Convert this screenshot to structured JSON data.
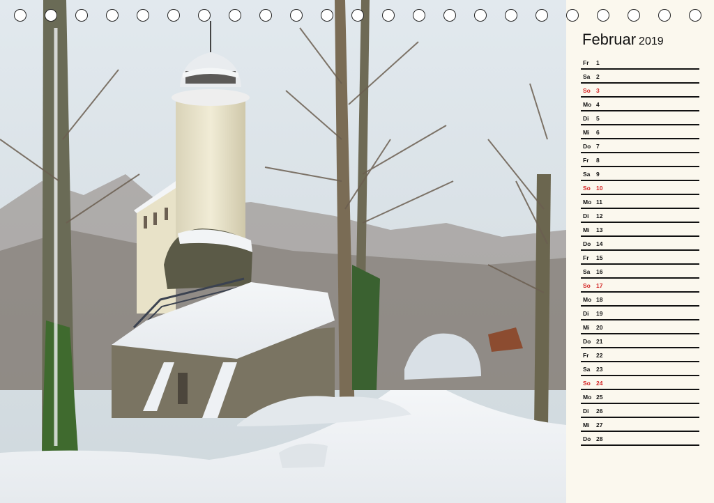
{
  "calendar": {
    "month": "Februar",
    "year": "2019",
    "colors": {
      "sunday": "#d32121",
      "text": "#111111",
      "panel_bg": "#fbf8ee"
    },
    "days": [
      {
        "name": "Fr",
        "num": "1",
        "sunday": false
      },
      {
        "name": "Sa",
        "num": "2",
        "sunday": false
      },
      {
        "name": "So",
        "num": "3",
        "sunday": true
      },
      {
        "name": "Mo",
        "num": "4",
        "sunday": false
      },
      {
        "name": "Di",
        "num": "5",
        "sunday": false
      },
      {
        "name": "Mi",
        "num": "6",
        "sunday": false
      },
      {
        "name": "Do",
        "num": "7",
        "sunday": false
      },
      {
        "name": "Fr",
        "num": "8",
        "sunday": false
      },
      {
        "name": "Sa",
        "num": "9",
        "sunday": false
      },
      {
        "name": "So",
        "num": "10",
        "sunday": true
      },
      {
        "name": "Mo",
        "num": "11",
        "sunday": false
      },
      {
        "name": "Di",
        "num": "12",
        "sunday": false
      },
      {
        "name": "Mi",
        "num": "13",
        "sunday": false
      },
      {
        "name": "Do",
        "num": "14",
        "sunday": false
      },
      {
        "name": "Fr",
        "num": "15",
        "sunday": false
      },
      {
        "name": "Sa",
        "num": "16",
        "sunday": false
      },
      {
        "name": "So",
        "num": "17",
        "sunday": true
      },
      {
        "name": "Mo",
        "num": "18",
        "sunday": false
      },
      {
        "name": "Di",
        "num": "19",
        "sunday": false
      },
      {
        "name": "Mi",
        "num": "20",
        "sunday": false
      },
      {
        "name": "Do",
        "num": "21",
        "sunday": false
      },
      {
        "name": "Fr",
        "num": "22",
        "sunday": false
      },
      {
        "name": "Sa",
        "num": "23",
        "sunday": false
      },
      {
        "name": "So",
        "num": "24",
        "sunday": true
      },
      {
        "name": "Mo",
        "num": "25",
        "sunday": false
      },
      {
        "name": "Di",
        "num": "26",
        "sunday": false
      },
      {
        "name": "Mi",
        "num": "27",
        "sunday": false
      },
      {
        "name": "Do",
        "num": "28",
        "sunday": false
      }
    ]
  }
}
